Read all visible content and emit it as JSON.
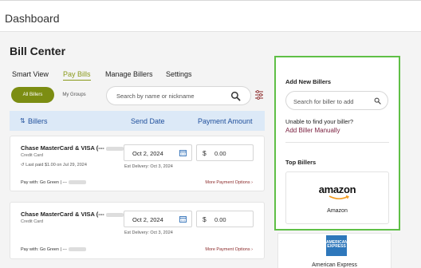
{
  "header": {
    "title": "Dashboard"
  },
  "page": {
    "title": "Bill Center"
  },
  "tabs": [
    {
      "label": "Smart View",
      "active": false
    },
    {
      "label": "Pay Bills",
      "active": true
    },
    {
      "label": "Manage Billers",
      "active": false
    },
    {
      "label": "Settings",
      "active": false
    }
  ],
  "filters": {
    "all": "All Billers",
    "groups": "My Groups"
  },
  "search": {
    "placeholder": "Search by name or nickname"
  },
  "table": {
    "columns": {
      "billers": "Billers",
      "send_date": "Send Date",
      "payment_amount": "Payment Amount"
    }
  },
  "bills": [
    {
      "name": "Chase MasterCard & VISA (---",
      "type": "Credit Card",
      "last_paid": "Last paid $1.00 on Jul 29, 2024",
      "send_date": "Oct 2, 2024",
      "est_delivery": "Est Delivery: Oct 3, 2024",
      "currency": "$",
      "amount": "0.00",
      "pay_with": "Pay with: Go Green | ---",
      "more_options": "More Payment Options"
    },
    {
      "name": "Chase MasterCard & VISA (---",
      "type": "Credit Card",
      "send_date": "Oct 2, 2024",
      "est_delivery": "Est Delivery: Oct 3, 2024",
      "currency": "$",
      "amount": "0.00",
      "pay_with": "Pay with: Go Green | ---",
      "more_options": "More Payment Options"
    }
  ],
  "sidebar": {
    "add_title": "Add New Billers",
    "search_placeholder": "Search for biller to add",
    "unable_text": "Unable to find your biller?",
    "add_manually": "Add Biller Manually",
    "top_title": "Top Billers",
    "top_billers": [
      {
        "logo_text": "amazon",
        "name": "Amazon"
      },
      {
        "logo_text": "AMERICAN EXPRESS",
        "name": "American Express"
      }
    ]
  },
  "colors": {
    "accent": "#7c8d12",
    "header_blue": "#dce9f7",
    "highlight": "#5fbf46",
    "link": "#7b2240"
  }
}
